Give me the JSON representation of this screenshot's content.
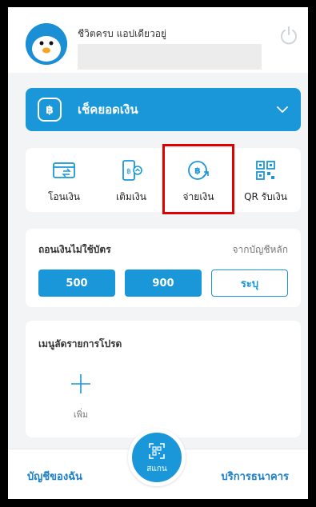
{
  "header": {
    "greeting": "ชีวิตครบ แอปเดียวอยู่"
  },
  "balance": {
    "label": "เช็คยอดเงิน"
  },
  "actions": [
    {
      "label": "โอนเงิน",
      "icon": "transfer-icon"
    },
    {
      "label": "เติมเงิน",
      "icon": "topup-icon"
    },
    {
      "label": "จ่ายเงิน",
      "icon": "pay-icon"
    },
    {
      "label": "QR รับเงิน",
      "icon": "qr-receive-icon"
    }
  ],
  "withdraw": {
    "title": "ถอนเงินไม่ใช้บัตร",
    "source": "จากบัญชีหลัก",
    "amounts": [
      "500",
      "900"
    ],
    "custom": "ระบุ"
  },
  "favorites": {
    "title": "เมนูลัดรายการโปรด",
    "add_label": "เพิ่ม"
  },
  "bottom_nav": {
    "my_account": "บัญชีของฉัน",
    "scan": "สแกน",
    "bank_services": "บริการธนาคาร"
  },
  "colors": {
    "primary": "#1a97d8",
    "highlight": "#e00000"
  }
}
